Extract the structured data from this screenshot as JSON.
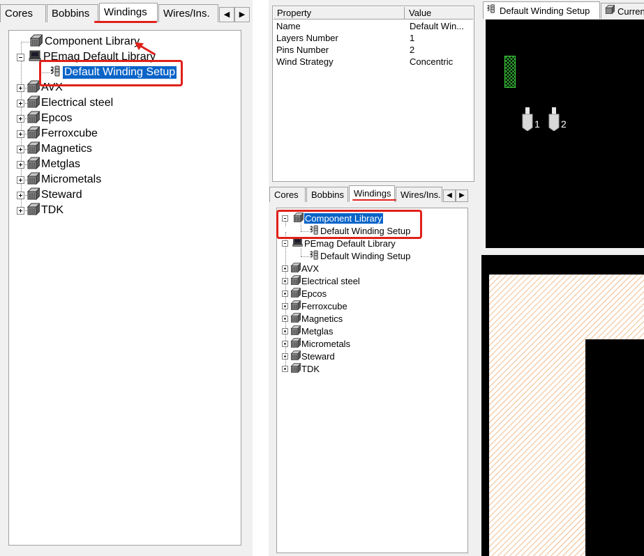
{
  "left_panel": {
    "tabs": [
      "Cores",
      "Bobbins",
      "Windings",
      "Wires/Ins."
    ],
    "active_tab": "Windings",
    "tree": [
      {
        "label": "Component Library",
        "icon": "library-icon"
      },
      {
        "label": "PEmag Default Library",
        "icon": "computer-icon"
      },
      {
        "label": "Default Winding Setup",
        "icon": "winding-icon"
      },
      {
        "label": "AVX",
        "icon": "library-icon"
      },
      {
        "label": "Electrical steel",
        "icon": "library-icon"
      },
      {
        "label": "Epcos",
        "icon": "library-icon"
      },
      {
        "label": "Ferroxcube",
        "icon": "library-icon"
      },
      {
        "label": "Magnetics",
        "icon": "library-icon"
      },
      {
        "label": "Metglas",
        "icon": "library-icon"
      },
      {
        "label": "Micrometals",
        "icon": "library-icon"
      },
      {
        "label": "Steward",
        "icon": "library-icon"
      },
      {
        "label": "TDK",
        "icon": "library-icon"
      }
    ]
  },
  "property_grid": {
    "headers": [
      "Property",
      "Value"
    ],
    "rows": [
      [
        "Name",
        "Default Win..."
      ],
      [
        "Layers Number",
        "1"
      ],
      [
        "Pins Number",
        "2"
      ],
      [
        "Wind Strategy",
        "Concentric"
      ]
    ]
  },
  "middle_panel": {
    "tabs": [
      "Cores",
      "Bobbins",
      "Windings",
      "Wires/Ins."
    ],
    "active_tab": "Windings",
    "tree": [
      {
        "label": "Component Library",
        "icon": "library-icon"
      },
      {
        "label": "Default Winding Setup",
        "icon": "winding-icon"
      },
      {
        "label": "PEmag Default Library",
        "icon": "computer-icon"
      },
      {
        "label": "Default Winding Setup",
        "icon": "winding-icon"
      },
      {
        "label": "AVX",
        "icon": "library-icon"
      },
      {
        "label": "Electrical steel",
        "icon": "library-icon"
      },
      {
        "label": "Epcos",
        "icon": "library-icon"
      },
      {
        "label": "Ferroxcube",
        "icon": "library-icon"
      },
      {
        "label": "Magnetics",
        "icon": "library-icon"
      },
      {
        "label": "Metglas",
        "icon": "library-icon"
      },
      {
        "label": "Micrometals",
        "icon": "library-icon"
      },
      {
        "label": "Steward",
        "icon": "library-icon"
      },
      {
        "label": "TDK",
        "icon": "library-icon"
      }
    ]
  },
  "preview": {
    "tabs": [
      "Default Winding Setup",
      "Curren"
    ],
    "pins": [
      "1",
      "2"
    ]
  },
  "colors": {
    "selection": "#0a64c8",
    "annotation": "#e0201a",
    "hatch": "#e8a060"
  }
}
